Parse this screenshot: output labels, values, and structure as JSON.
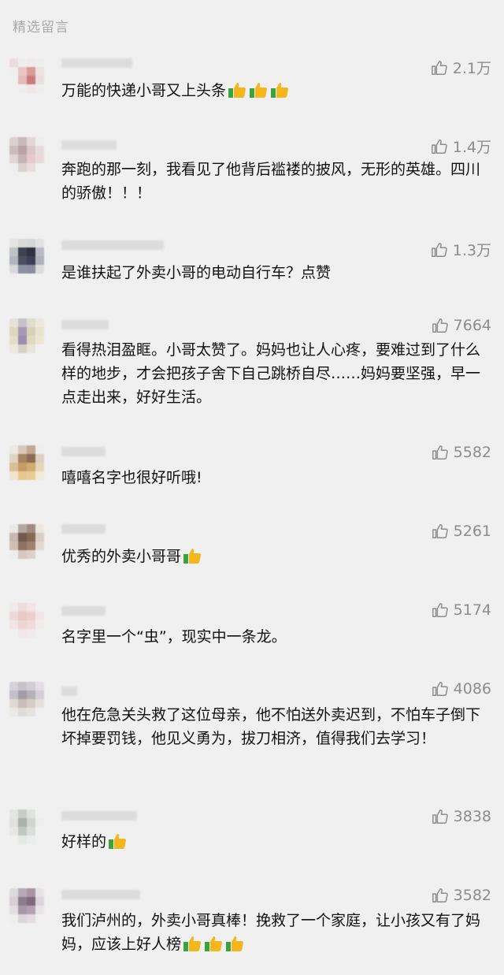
{
  "section_title": "精选留言",
  "comments": [
    {
      "likes": "2.1万",
      "text": "万能的快递小哥又上头条",
      "emoji_count": 3
    },
    {
      "likes": "1.4万",
      "text": "奔跑的那一刻，我看见了他背后褴褛的披风，无形的英雄。四川的骄傲！！！",
      "emoji_count": 0
    },
    {
      "likes": "1.3万",
      "text": "是谁扶起了外卖小哥的电动自行车？点赞",
      "emoji_count": 0
    },
    {
      "likes": "7664",
      "text": "看得热泪盈眶。小哥太赞了。妈妈也让人心疼，要难过到了什么样的地步，才会把孩子舍下自己跳桥自尽……妈妈要坚强，早一点走出来，好好生活。",
      "emoji_count": 0
    },
    {
      "likes": "5582",
      "text": "嘻嘻名字也很好听哦!",
      "emoji_count": 0
    },
    {
      "likes": "5261",
      "text": "优秀的外卖小哥哥",
      "emoji_count": 1
    },
    {
      "likes": "5174",
      "text": "名字里一个“虫”，现实中一条龙。",
      "emoji_count": 0
    },
    {
      "likes": "4086",
      "text": "他在危急关头救了这位母亲，他不怕送外卖迟到，不怕车子倒下坏掉要罚钱，他见义勇为，拔刀相济，值得我们去学习！",
      "emoji_count": 0
    },
    {
      "likes": "3838",
      "text": "好样的",
      "emoji_count": 1
    },
    {
      "likes": "3582",
      "text": "我们泸州的，外卖小哥真棒！挽救了一个家庭，让小孩又有了妈妈，应该上好人榜",
      "emoji_count": 3
    }
  ],
  "colors": {
    "background": "#f0f0f0",
    "like_gray": "#8c8c8c",
    "emoji_yellow": "#f5b51c",
    "emoji_green": "#3aa33a"
  },
  "icons": {
    "like": "thumbs-up-outline-icon",
    "emoji": "thumbs-up-emoji-icon"
  }
}
